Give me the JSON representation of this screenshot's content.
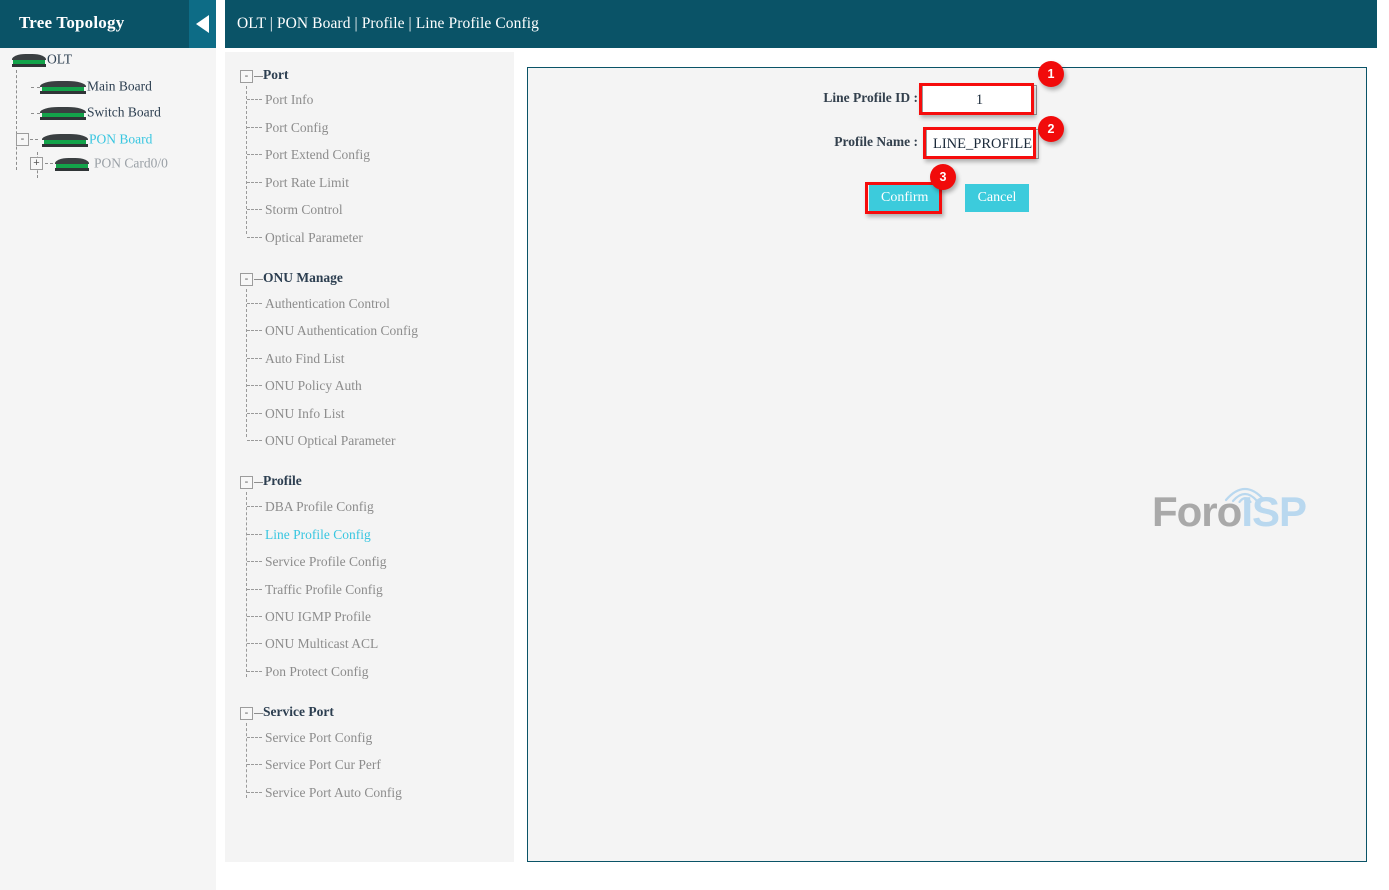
{
  "sidebar": {
    "title": "Tree Topology",
    "collapse_icon": "caret-left-icon",
    "tree": [
      {
        "label": "OLT",
        "state": "dark",
        "icon": "device-chassis-icon",
        "expander": null
      },
      {
        "label": "Main Board",
        "state": "dark",
        "icon": "device-chassis-icon",
        "expander": null
      },
      {
        "label": "Switch Board",
        "state": "dark",
        "icon": "device-chassis-icon",
        "expander": null
      },
      {
        "label": "PON Board",
        "state": "active",
        "icon": "device-chassis-icon",
        "expander": "-"
      },
      {
        "label": "PON Card0/0",
        "state": "muted",
        "icon": "device-chassis-icon",
        "expander": "+"
      }
    ]
  },
  "topbar": {
    "breadcrumb": "OLT | PON Board | Profile | Line Profile Config"
  },
  "menu": {
    "groups": [
      {
        "label": "Port",
        "expander": "-",
        "items": [
          "Port Info",
          "Port Config",
          "Port Extend Config",
          "Port Rate Limit",
          "Storm Control",
          "Optical Parameter"
        ]
      },
      {
        "label": "ONU Manage",
        "expander": "-",
        "items": [
          "Authentication Control",
          "ONU Authentication Config",
          "Auto Find List",
          "ONU Policy Auth",
          "ONU Info List",
          "ONU Optical Parameter"
        ]
      },
      {
        "label": "Profile",
        "expander": "-",
        "items": [
          "DBA Profile Config",
          "Line Profile Config",
          "Service Profile Config",
          "Traffic Profile Config",
          "ONU IGMP Profile",
          "ONU Multicast ACL",
          "Pon Protect Config"
        ]
      },
      {
        "label": "Service Port",
        "expander": "-",
        "items": [
          "Service Port Config",
          "Service Port Cur Perf",
          "Service Port Auto Config"
        ]
      }
    ],
    "active_item": "Line Profile Config"
  },
  "form": {
    "fields": [
      {
        "label": "Line Profile ID :",
        "value": "1",
        "align": "center"
      },
      {
        "label": "Profile Name :",
        "value": "LINE_PROFILE",
        "align": "left"
      }
    ],
    "confirm_label": "Confirm",
    "cancel_label": "Cancel"
  },
  "annotations": {
    "badges": [
      "1",
      "2",
      "3"
    ]
  },
  "watermark": {
    "text_primary": "Foro",
    "text_secondary": "ISP"
  },
  "colors": {
    "header_teal": "#0a5367",
    "accent_cyan": "#38c6e0",
    "button_cyan": "#3ccbdc",
    "highlight_red": "#f60c0c",
    "panel_gray": "#f4f4f4"
  }
}
